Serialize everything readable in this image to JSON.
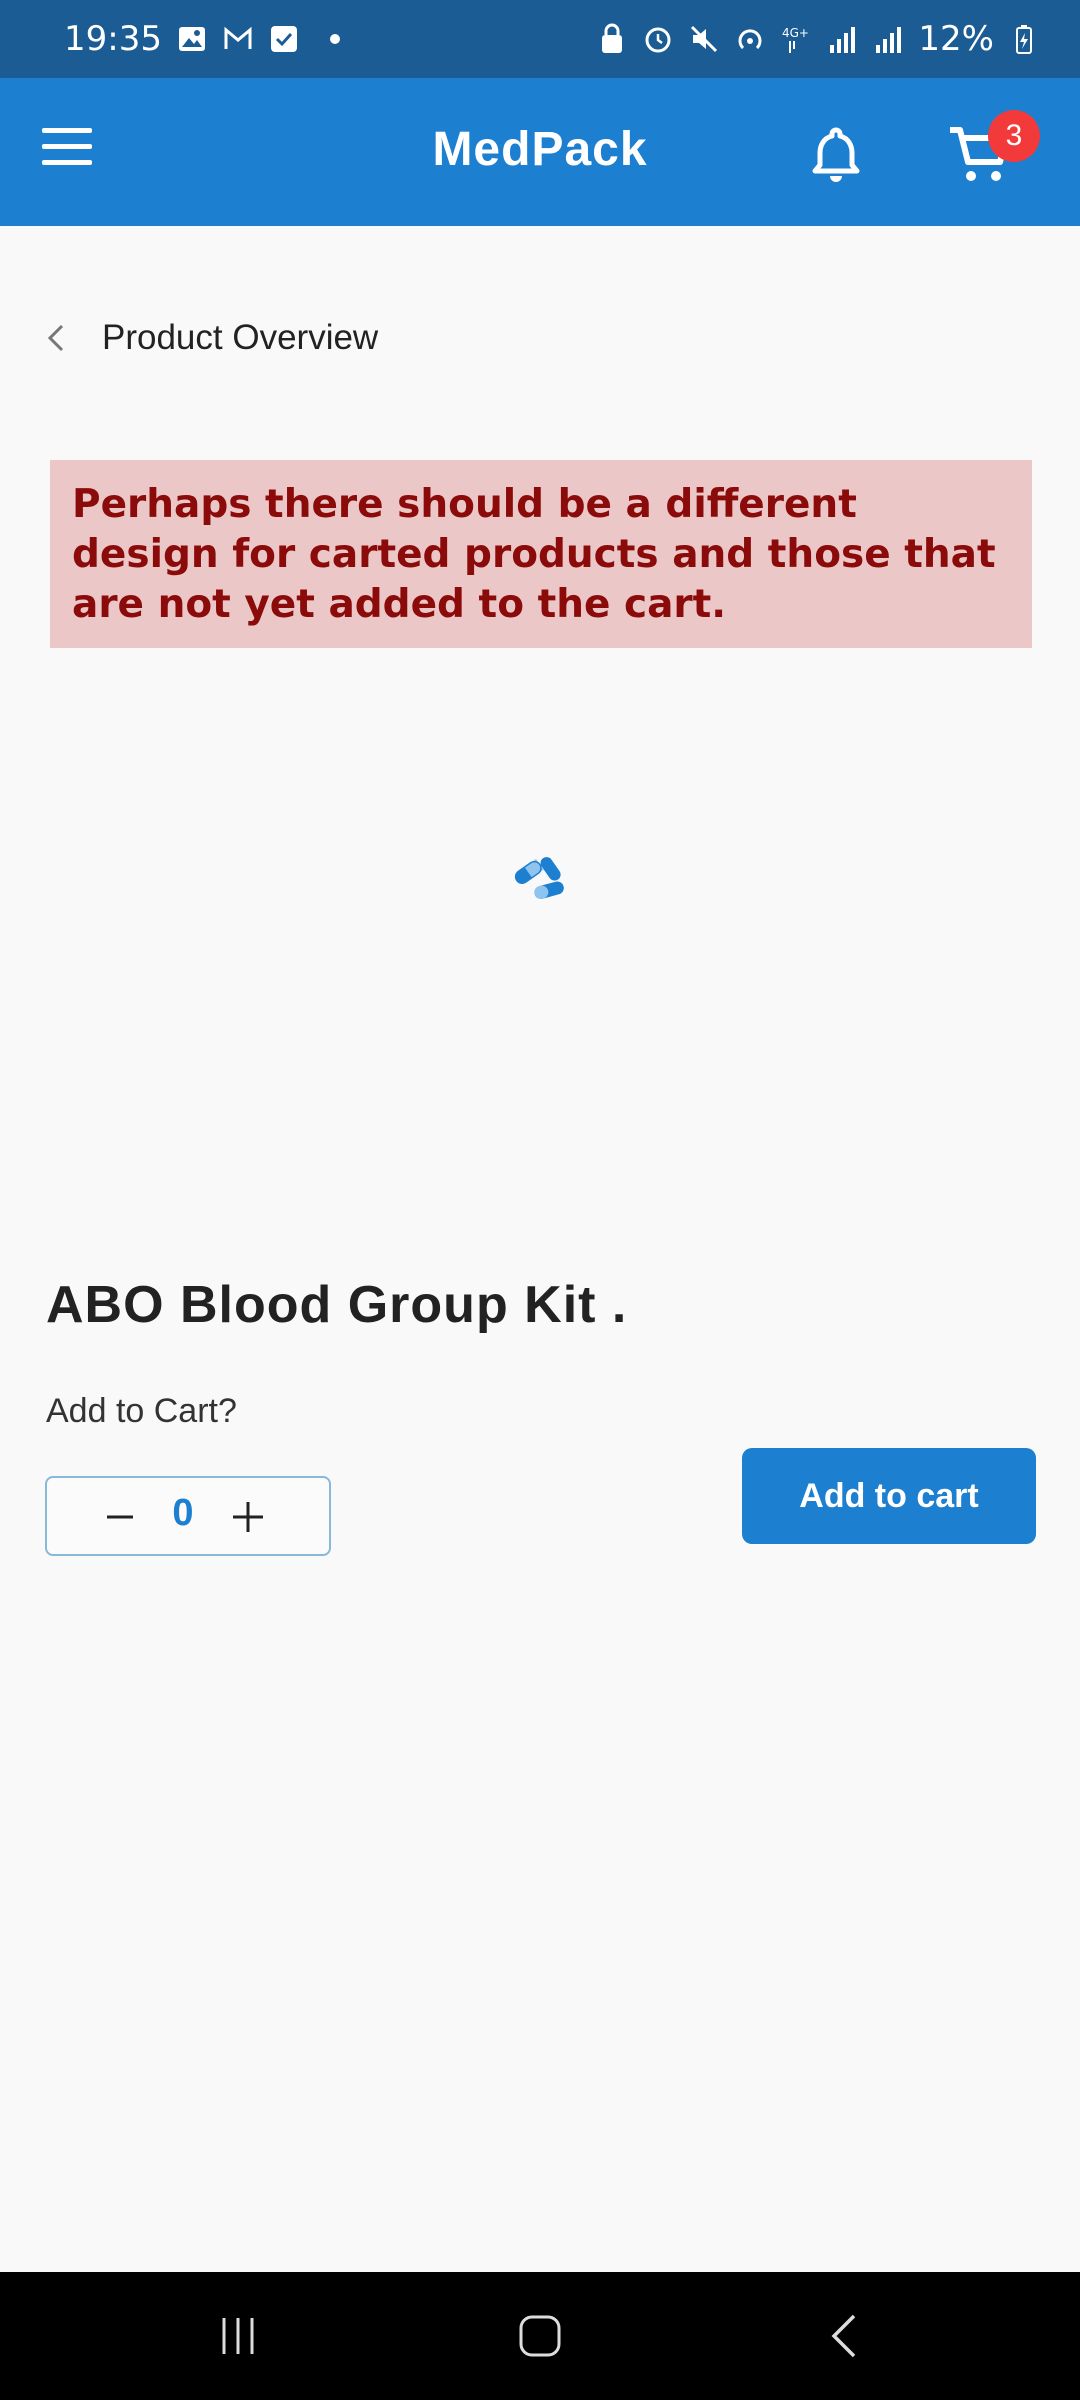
{
  "status_bar": {
    "time": "19:35",
    "battery": "12%",
    "left_icons": [
      "gallery-icon",
      "gmail-icon",
      "check-icon",
      "dot-icon"
    ],
    "right_icons": [
      "lock-icon",
      "alarm-icon",
      "mute-icon",
      "hotspot-icon",
      "4g-icon",
      "signal-icon",
      "signal-icon",
      "battery-icon"
    ]
  },
  "app_bar": {
    "title": "MedPack",
    "cart_count": "3",
    "background": "#1c7fd0"
  },
  "page": {
    "back_title": "Product Overview"
  },
  "note": {
    "text": "Perhaps there should be a different design for carted products and those that are not yet added to the cart."
  },
  "product": {
    "name": "ABO Blood Group Kit .",
    "prompt": "Add to Cart?",
    "quantity": "0",
    "add_button": "Add to cart",
    "image_icon": "pills-icon"
  },
  "colors": {
    "accent": "#1c7fd0",
    "status_bar": "#1b5c94",
    "badge": "#f23a3a",
    "note_bg": "#ebc7c8",
    "note_text": "#8b0a0a"
  }
}
